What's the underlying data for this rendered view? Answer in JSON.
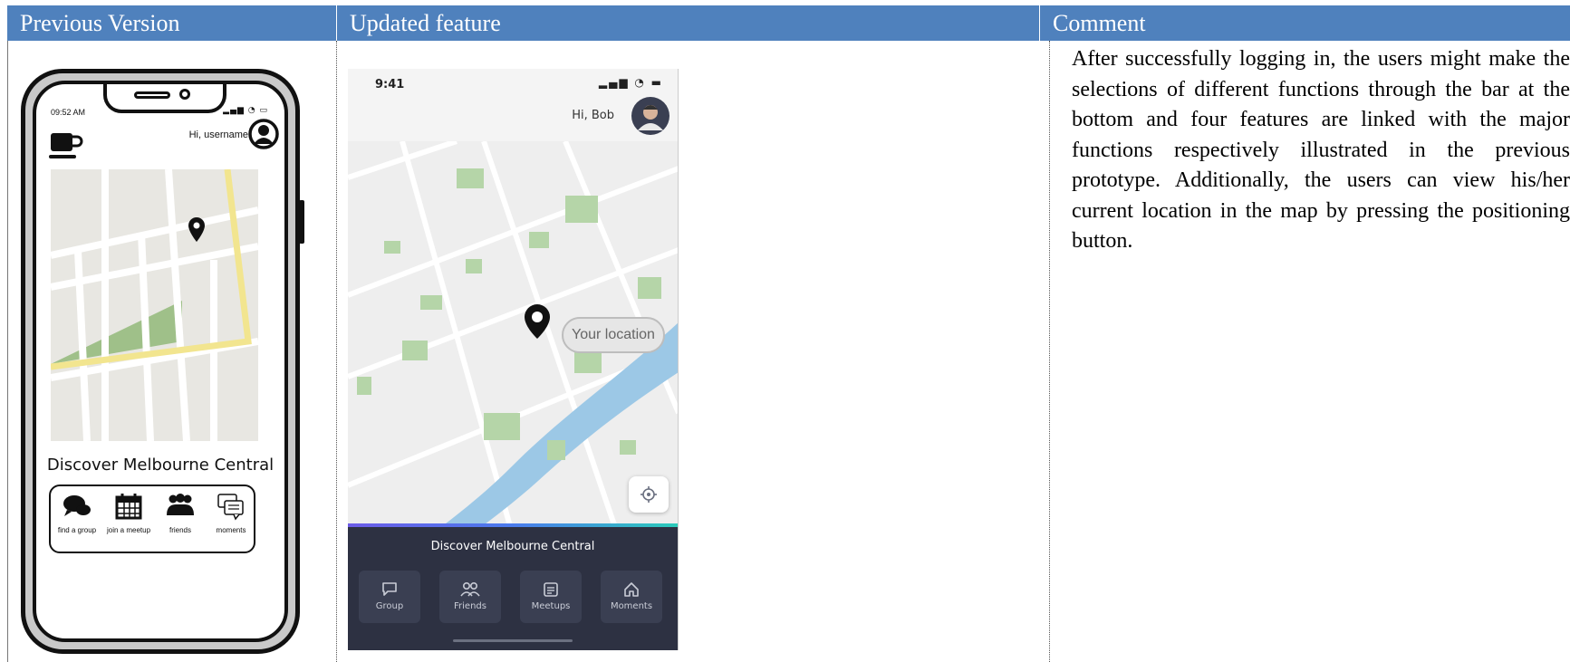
{
  "table": {
    "headers": [
      "Previous Version",
      "Updated feature",
      "Comment"
    ],
    "comment": "After successfully logging in, the users might make the selections of different functions through the bar at the bottom and four features are linked with the major functions respectively illustrated in the previous prototype. Additionally, the users can view his/her current location in the map by pressing the positioning button."
  },
  "previous": {
    "time": "09:52 AM",
    "greeting": "Hi, username",
    "title": "Discover Melbourne Central",
    "nav": [
      {
        "label": "find a group",
        "icon": "chat-bubbles-icon"
      },
      {
        "label": "join a meetup",
        "icon": "calendar-icon"
      },
      {
        "label": "friends",
        "icon": "users-icon"
      },
      {
        "label": "moments",
        "icon": "comments-icon"
      }
    ]
  },
  "updated": {
    "time": "9:41",
    "greeting": "Hi, Bob",
    "location_label": "Your location",
    "title": "Discover Melbourne Central",
    "tabs": [
      {
        "label": "Group",
        "icon": "chat-icon"
      },
      {
        "label": "Friends",
        "icon": "friends-icon"
      },
      {
        "label": "Meetups",
        "icon": "calendar-list-icon"
      },
      {
        "label": "Moments",
        "icon": "home-icon"
      }
    ]
  },
  "colors": {
    "header_bg": "#4f81bd",
    "panel_bg": "#2d3142",
    "park_green": "#b5d5a8",
    "river_blue": "#9cc8e6"
  }
}
